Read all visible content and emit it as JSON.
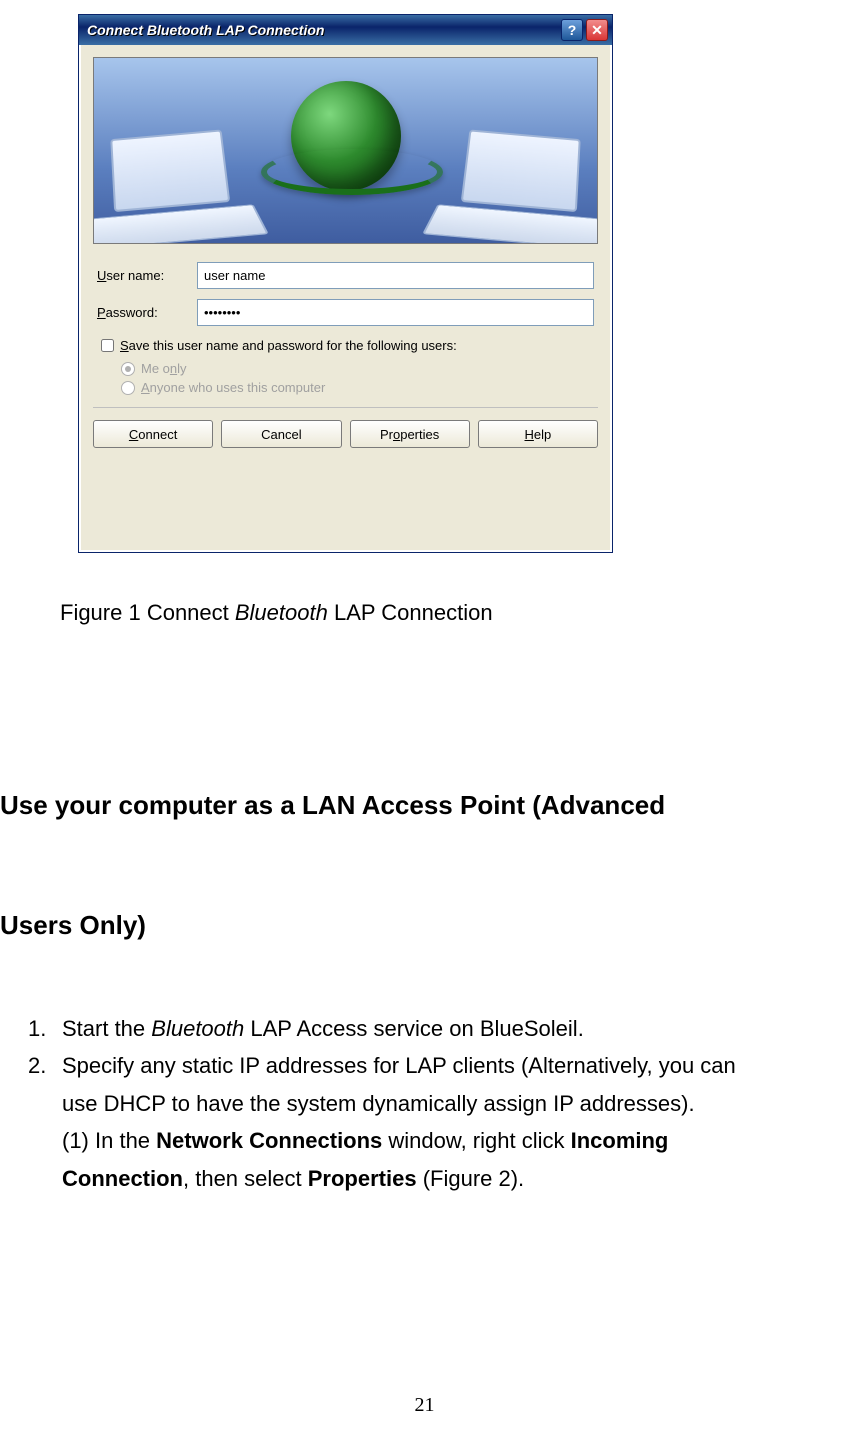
{
  "dialog": {
    "title": "Connect Bluetooth LAP Connection",
    "username_label_pre": "U",
    "username_label_rest": "ser name:",
    "username_value": "user name",
    "password_label_pre": "P",
    "password_label_rest": "assword:",
    "password_value": "••••••••",
    "save_pre": "S",
    "save_rest": "ave this user name and password for the following users:",
    "radio_me_pre": "Me o",
    "radio_me_mid": "n",
    "radio_me_rest": "ly",
    "radio_any_pre": "A",
    "radio_any_rest": "nyone who uses this computer",
    "buttons": {
      "connect_u": "C",
      "connect_rest": "onnect",
      "cancel": "Cancel",
      "props_pre": "Pr",
      "props_u": "o",
      "props_rest": "perties",
      "help_u": "H",
      "help_rest": "elp"
    },
    "help_icon": "?",
    "close_icon": "✕"
  },
  "caption": {
    "pre": "Figure 1 Connect ",
    "it": "Bluetooth",
    "post": " LAP Connection"
  },
  "heading_line1": "Use your computer as a LAN Access Point (Advanced",
  "heading_line2": "Users Only)",
  "list": {
    "n1": "1.",
    "i1_pre": "Start the ",
    "i1_it": "Bluetooth",
    "i1_post": " LAP Access service on BlueSoleil.",
    "n2": "2.",
    "i2_l1": "Specify any static IP addresses for LAP clients (Alternatively, you can",
    "i2_l2": "use DHCP to have the system dynamically assign IP addresses).",
    "i2_l3_pre": "(1) In the ",
    "i2_l3_b1": "Network Connections",
    "i2_l3_mid": " window, right click ",
    "i2_l3_b2": "Incoming",
    "i2_l4_b1": "Connection",
    "i2_l4_mid": ", then select ",
    "i2_l4_b2": "Properties",
    "i2_l4_post": " (Figure 2)."
  },
  "page_number": "21"
}
